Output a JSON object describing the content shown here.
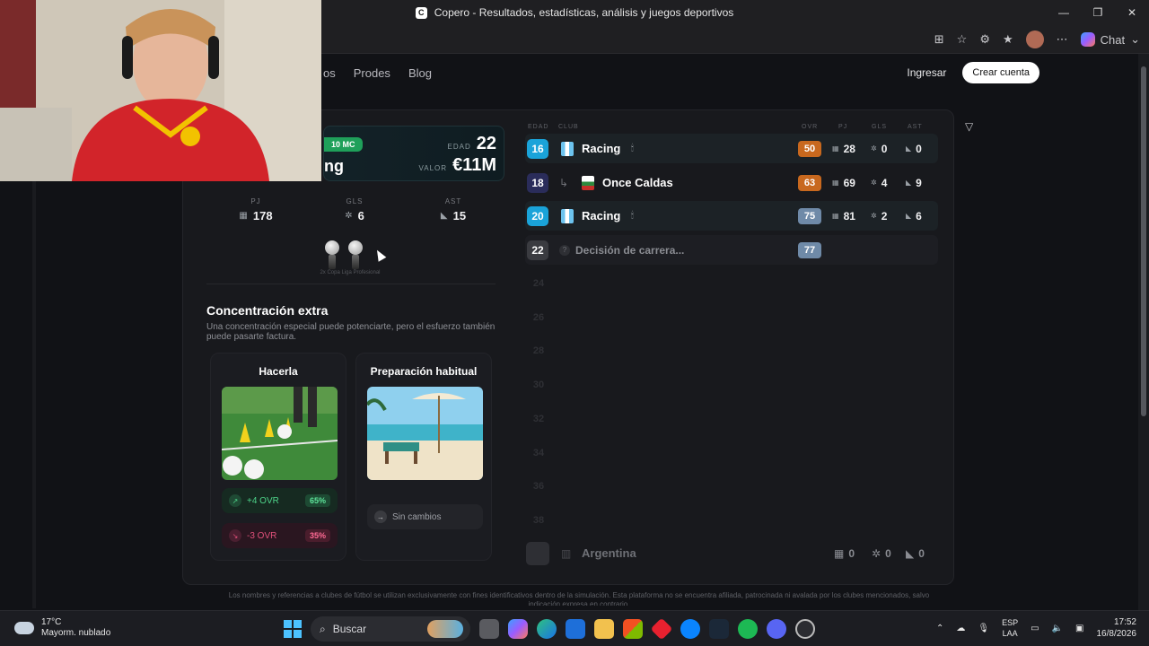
{
  "browser": {
    "title": "Copero - Resultados, estadísticas, análisis y juegos deportivos",
    "chat_label": "Chat"
  },
  "nav": {
    "links": [
      "os",
      "Prodes",
      "Blog"
    ],
    "login": "Ingresar",
    "signup": "Crear cuenta"
  },
  "player": {
    "position_badge": "10 MC",
    "name": "ng",
    "age_label": "EDAD",
    "age": "22",
    "value_label": "VALOR",
    "value": "€11M",
    "stats": [
      {
        "label": "PJ",
        "value": "178",
        "icon": "shirt-icon"
      },
      {
        "label": "GLS",
        "value": "6",
        "icon": "ball-icon"
      },
      {
        "label": "AST",
        "value": "15",
        "icon": "boot-icon"
      }
    ],
    "trophy_caption": "2x Copa Liga Profesional"
  },
  "decision": {
    "title": "Concentración extra",
    "description": "Una concentración especial puede potenciarte, pero el esfuerzo también puede pasarte factura.",
    "options": [
      {
        "title": "Hacerla",
        "outcomes": [
          {
            "label": "+4 OVR",
            "pct": "65%",
            "kind": "up"
          },
          {
            "label": "-3 OVR",
            "pct": "35%",
            "kind": "down"
          }
        ]
      },
      {
        "title": "Preparación habitual",
        "outcomes": [
          {
            "label": "Sin cambios",
            "kind": "neutral"
          }
        ]
      }
    ]
  },
  "career": {
    "headers": [
      "EDAD",
      "CLUB",
      "OVR",
      "PJ",
      "GLS",
      "AST"
    ],
    "rows": [
      {
        "age": "16",
        "club": "Racing",
        "ovr": "50",
        "pj": "28",
        "gls": "0",
        "ast": "0",
        "age_color": "#1aa3d9",
        "ovr_color": "#c8681e"
      },
      {
        "age": "18",
        "club": "Once Caldas",
        "ovr": "63",
        "pj": "69",
        "gls": "4",
        "ast": "9",
        "age_color": "#2a2c5a",
        "ovr_color": "#c8681e"
      },
      {
        "age": "20",
        "club": "Racing",
        "ovr": "75",
        "pj": "81",
        "gls": "2",
        "ast": "6",
        "age_color": "#1aa3d9",
        "ovr_color": "#6f8aa8"
      },
      {
        "age": "22",
        "club": "Decisión de carrera...",
        "ovr": "77",
        "age_color": "#3a3b40",
        "ovr_color": "#6f8aa8"
      }
    ],
    "future_ages": [
      "24",
      "26",
      "28",
      "30",
      "32",
      "34",
      "36",
      "38"
    ],
    "national": {
      "name": "Argentina",
      "pj": "0",
      "gls": "0",
      "ast": "0"
    }
  },
  "footer": "Los nombres y referencias a clubes de fútbol se utilizan exclusivamente con fines identificativos dentro de la simulación. Esta plataforma no se encuentra afiliada, patrocinada ni avalada por los clubes mencionados, salvo indicación expresa en contrario.",
  "taskbar": {
    "temp": "17°C",
    "weather": "Mayorm. nublado",
    "search": "Buscar",
    "lang1": "ESP",
    "lang2": "LAA",
    "time": "17:52",
    "date": "16/8/2026"
  }
}
